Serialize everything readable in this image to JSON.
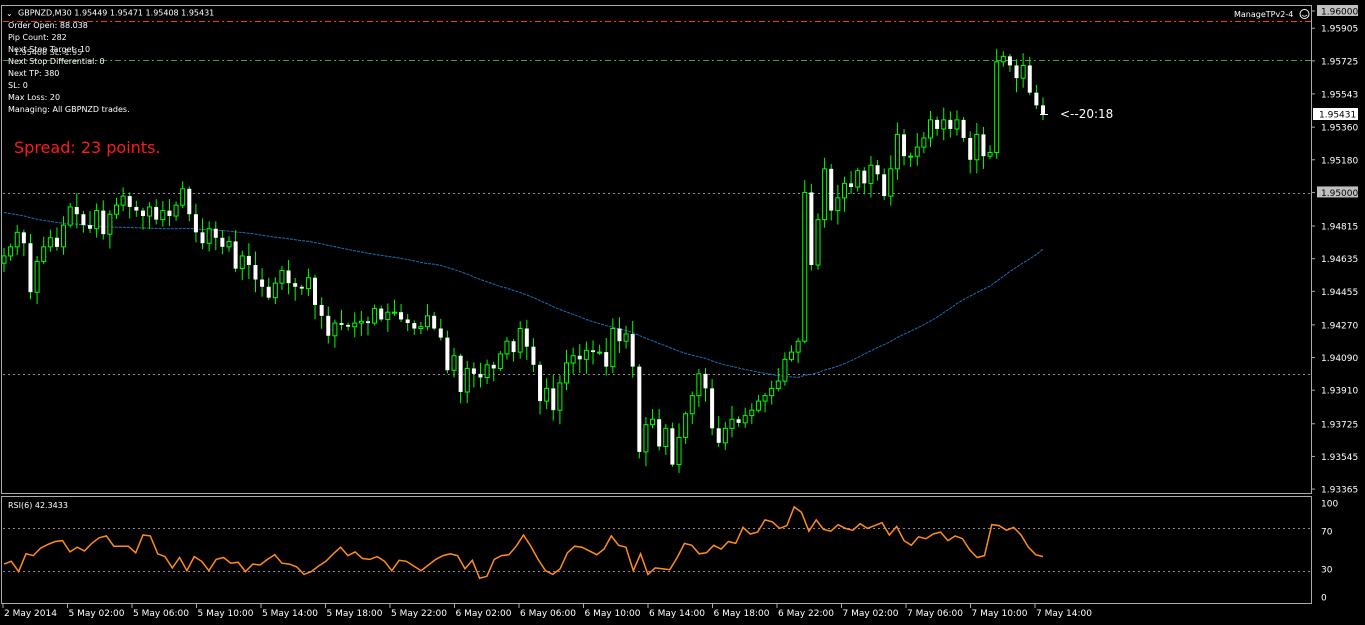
{
  "header": {
    "symbol_line": "GBPNZD,M30  1.95449 1.95471 1.95408 1.95431",
    "expert_name": "ManageTPv2-4"
  },
  "info_panel": {
    "order_open": "Order Open: 88.038",
    "pip_count": "Pip Count: 282",
    "next_stop_target": "Next Stop Target: 10",
    "next_stop_target_overlay": "1.95408 SL: 1.95",
    "next_stop_differential": "Next Stop Differential: 0",
    "next_tp": "Next TP: 380",
    "sl": "SL: 0",
    "max_loss": "Max Loss: 20",
    "managing": "Managing: All GBPNZD trades."
  },
  "spread_text": "Spread: 23 points.",
  "countdown": "<--20:18",
  "colors": {
    "background": "#000000",
    "candle_fill": "#ffffff",
    "candle_wick": "#00ff00",
    "moving_average": "#1e6fb3",
    "rsi_line": "#ff8c1a",
    "spread_text": "#ff1a1a",
    "red_level": "#ff3030",
    "green_level": "#33aa33",
    "grid_level": "#8a8a8a"
  },
  "chart_data": [
    {
      "type": "candlestick",
      "symbol": "GBPNZD",
      "timeframe": "M30",
      "ylim": [
        1.9336,
        1.96
      ],
      "y_ticks": [
        "1.96000",
        "1.95905",
        "1.95725",
        "1.95543",
        "1.95360",
        "1.95180",
        "1.95000",
        "1.94815",
        "1.94635",
        "1.94455",
        "1.94270",
        "1.94090",
        "1.93910",
        "1.93725",
        "1.93545",
        "1.93365"
      ],
      "highlighted_ticks": [
        "1.96000",
        "1.95000",
        "1.94000"
      ],
      "current_price_label": "1.95431",
      "x_ticks": [
        "2 May 2014",
        "5 May 02:00",
        "5 May 06:00",
        "5 May 10:00",
        "5 May 14:00",
        "5 May 18:00",
        "5 May 22:00",
        "6 May 02:00",
        "6 May 06:00",
        "6 May 10:00",
        "6 May 14:00",
        "6 May 18:00",
        "6 May 22:00",
        "7 May 02:00",
        "7 May 06:00",
        "7 May 10:00",
        "7 May 14:00"
      ],
      "levels": {
        "red_dashed": 1.9596,
        "green_dashdot": 1.9573,
        "grey_dotted_upper": 1.95,
        "grey_dotted_lower": 1.94
      },
      "closes": [
        1.9465,
        1.947,
        1.9478,
        1.9472,
        1.9445,
        1.9462,
        1.947,
        1.9475,
        1.947,
        1.9482,
        1.9492,
        1.9488,
        1.9482,
        1.948,
        1.949,
        1.9477,
        1.9488,
        1.9493,
        1.9498,
        1.9492,
        1.949,
        1.9487,
        1.9492,
        1.9485,
        1.949,
        1.9487,
        1.9493,
        1.9502,
        1.9488,
        1.9478,
        1.9472,
        1.948,
        1.9475,
        1.947,
        1.9473,
        1.9458,
        1.9465,
        1.946,
        1.9452,
        1.9448,
        1.9442,
        1.945,
        1.9457,
        1.945,
        1.9448,
        1.9447,
        1.9453,
        1.9438,
        1.9432,
        1.9421,
        1.9428,
        1.9427,
        1.9426,
        1.9428,
        1.9429,
        1.9428,
        1.9436,
        1.943,
        1.9434,
        1.9434,
        1.943,
        1.9428,
        1.9425,
        1.9426,
        1.9432,
        1.9425,
        1.942,
        1.9402,
        1.941,
        1.939,
        1.9403,
        1.94,
        1.9398,
        1.9405,
        1.9403,
        1.9411,
        1.9418,
        1.9412,
        1.9425,
        1.9415,
        1.9405,
        1.9385,
        1.9392,
        1.938,
        1.9395,
        1.9406,
        1.941,
        1.9408,
        1.9413,
        1.9412,
        1.9412,
        1.9404,
        1.9425,
        1.9418,
        1.9422,
        1.9404,
        1.9357,
        1.9372,
        1.9375,
        1.936,
        1.937,
        1.935,
        1.9365,
        1.9378,
        1.9388,
        1.94,
        1.9392,
        1.937,
        1.9362,
        1.937,
        1.9375,
        1.9373,
        1.9377,
        1.938,
        1.9385,
        1.9388,
        1.9392,
        1.9396,
        1.9408,
        1.9412,
        1.9418,
        1.95,
        1.946,
        1.9485,
        1.9513,
        1.949,
        1.9497,
        1.9505,
        1.9503,
        1.9512,
        1.9505,
        1.9515,
        1.951,
        1.9498,
        1.9513,
        1.9532,
        1.952,
        1.952,
        1.9525,
        1.953,
        1.954,
        1.9535,
        1.954,
        1.9535,
        1.954,
        1.953,
        1.9518,
        1.9532,
        1.952,
        1.9522,
        1.9572,
        1.9575,
        1.957,
        1.9563,
        1.957,
        1.9555,
        1.9548,
        1.9543
      ]
    },
    {
      "type": "line",
      "title": "RSI(6) 42.3433",
      "ylim": [
        0,
        100
      ],
      "y_ticks": [
        "100",
        "70",
        "30",
        "0"
      ],
      "levels": [
        70,
        30
      ],
      "values": [
        35,
        38,
        27,
        46,
        44,
        52,
        56,
        59,
        60,
        48,
        53,
        49,
        57,
        63,
        65,
        54,
        54,
        54,
        47,
        66,
        65,
        46,
        43,
        31,
        42,
        28,
        43,
        38,
        28,
        40,
        42,
        36,
        37,
        27,
        35,
        34,
        40,
        45,
        36,
        35,
        32,
        24,
        27,
        33,
        38,
        46,
        53,
        44,
        48,
        41,
        40,
        43,
        38,
        28,
        39,
        38,
        33,
        28,
        34,
        40,
        44,
        46,
        44,
        30,
        39,
        20,
        22,
        40,
        44,
        45,
        54,
        66,
        54,
        40,
        28,
        24,
        30,
        47,
        54,
        53,
        49,
        45,
        51,
        65,
        55,
        53,
        28,
        46,
        24,
        31,
        30,
        29,
        42,
        57,
        55,
        46,
        47,
        55,
        51,
        59,
        57,
        74,
        67,
        69,
        82,
        80,
        73,
        76,
        96,
        90,
        70,
        82,
        72,
        70,
        77,
        73,
        71,
        78,
        73,
        76,
        79,
        66,
        75,
        60,
        55,
        64,
        62,
        67,
        69,
        60,
        65,
        62,
        50,
        42,
        44,
        77,
        76,
        71,
        74,
        66,
        53,
        45,
        43
      ]
    }
  ]
}
